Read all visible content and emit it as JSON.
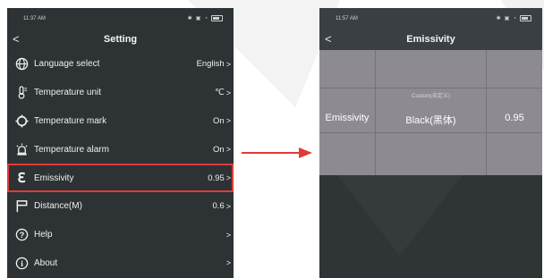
{
  "left_screen": {
    "status_time": "11:37 AM",
    "header": {
      "back": "<",
      "title": "Setting"
    },
    "menu": [
      {
        "icon": "globe-icon",
        "label": "Language select",
        "value": "English",
        "chevron": ">"
      },
      {
        "icon": "thermometer-icon",
        "label": "Temperature unit",
        "value": "℃",
        "chevron": ">"
      },
      {
        "icon": "crosshair-icon",
        "label": "Temperature mark",
        "value": "On",
        "chevron": ">"
      },
      {
        "icon": "alarm-light-icon",
        "label": "Temperature alarm",
        "value": "On",
        "chevron": ">"
      },
      {
        "icon": "epsilon-icon",
        "label": "Emissivity",
        "value": "0.95",
        "chevron": ">"
      },
      {
        "icon": "flag-icon",
        "label": "Distance(M)",
        "value": "0.6",
        "chevron": ">"
      },
      {
        "icon": "question-circle-icon",
        "label": "Help",
        "value": "",
        "chevron": ">"
      },
      {
        "icon": "info-circle-icon",
        "label": "About",
        "value": "",
        "chevron": ">"
      }
    ],
    "highlighted_item": "Emissivity",
    "highlight_color": "#e23a3a"
  },
  "right_screen": {
    "status_time": "11:57 AM",
    "header": {
      "back": "<",
      "title": "Emissivity"
    },
    "picker": {
      "above": "Custom(自定义)",
      "label": "Emissivity",
      "material": "Black(黑体)",
      "value": "0.95"
    }
  },
  "colors": {
    "screen_bg": "#2d3234",
    "picker_bg": "#8e8a92",
    "arrow": "#e23a3a"
  }
}
